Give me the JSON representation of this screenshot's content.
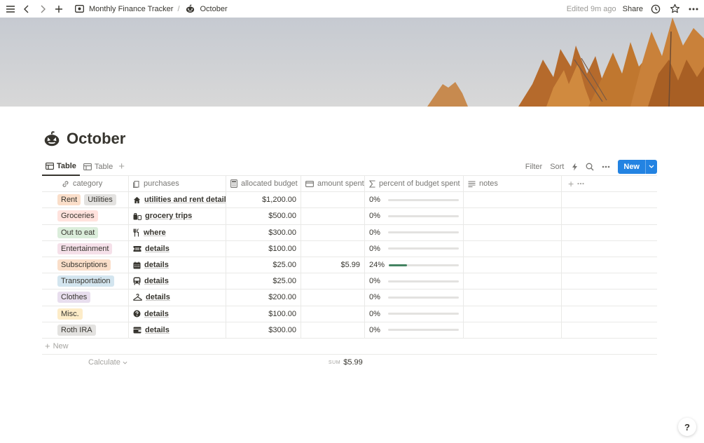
{
  "topbar": {
    "breadcrumb": [
      {
        "label": "Monthly Finance Tracker",
        "icon": "tracker-icon"
      },
      {
        "label": "October",
        "icon": "pumpkin-icon"
      }
    ],
    "separator": "/",
    "edited": "Edited 9m ago",
    "share_label": "Share"
  },
  "page": {
    "title": "October",
    "title_icon": "pumpkin-icon"
  },
  "views": {
    "tabs": [
      {
        "label": "Table",
        "active": true
      },
      {
        "label": "Table",
        "active": false
      }
    ],
    "filter_label": "Filter",
    "sort_label": "Sort",
    "new_label": "New"
  },
  "table": {
    "columns": [
      {
        "label": "category",
        "icon": "link-icon"
      },
      {
        "label": "purchases",
        "icon": "doc-icon"
      },
      {
        "label": "allocated budget",
        "icon": "calculator-icon"
      },
      {
        "label": "amount spent",
        "icon": "card-icon"
      },
      {
        "label": "percent of budget spent",
        "icon": "sigma-icon"
      },
      {
        "label": "notes",
        "icon": "lines-icon"
      }
    ],
    "rows": [
      {
        "tags": [
          {
            "label": "Rent",
            "color": "#fadec9"
          },
          {
            "label": "Utilities",
            "color": "#e3e2e0"
          }
        ],
        "purchase_icon": "house-icon",
        "purchase": "utilities and rent details",
        "budget": "$1,200.00",
        "spent": "",
        "percent": "0%",
        "fraction": 0
      },
      {
        "tags": [
          {
            "label": "Groceries",
            "color": "#ffe2dd"
          }
        ],
        "purchase_icon": "bag-icon",
        "purchase": "grocery trips",
        "budget": "$500.00",
        "spent": "",
        "percent": "0%",
        "fraction": 0
      },
      {
        "tags": [
          {
            "label": "Out to eat",
            "color": "#dbeddb"
          }
        ],
        "purchase_icon": "fork-knife-icon",
        "purchase": "where",
        "budget": "$300.00",
        "spent": "",
        "percent": "0%",
        "fraction": 0
      },
      {
        "tags": [
          {
            "label": "Entertainment",
            "color": "#f5e0e9"
          }
        ],
        "purchase_icon": "ticket-icon",
        "purchase": "details",
        "budget": "$100.00",
        "spent": "",
        "percent": "0%",
        "fraction": 0
      },
      {
        "tags": [
          {
            "label": "Subscriptions",
            "color": "#fadec9"
          }
        ],
        "purchase_icon": "calendar-icon",
        "purchase": "details",
        "budget": "$25.00",
        "spent": "$5.99",
        "percent": "24%",
        "fraction": 0.24
      },
      {
        "tags": [
          {
            "label": "Transportation",
            "color": "#d3e5ef"
          }
        ],
        "purchase_icon": "bus-icon",
        "purchase": "details",
        "budget": "$25.00",
        "spent": "",
        "percent": "0%",
        "fraction": 0
      },
      {
        "tags": [
          {
            "label": "Clothes",
            "color": "#e8deee"
          }
        ],
        "purchase_icon": "hanger-icon",
        "purchase": "details",
        "budget": "$200.00",
        "spent": "",
        "percent": "0%",
        "fraction": 0
      },
      {
        "tags": [
          {
            "label": "Misc.",
            "color": "#fdecc8"
          }
        ],
        "purchase_icon": "question-icon",
        "purchase": "details",
        "budget": "$100.00",
        "spent": "",
        "percent": "0%",
        "fraction": 0
      },
      {
        "tags": [
          {
            "label": "Roth IRA",
            "color": "#e3e2e0"
          }
        ],
        "purchase_icon": "wallet-icon",
        "purchase": "details",
        "budget": "$300.00",
        "spent": "",
        "percent": "0%",
        "fraction": 0
      }
    ],
    "new_row_label": "New",
    "calculate_label": "Calculate",
    "sum_key": "SUM",
    "sum_value": "$5.99"
  },
  "help_label": "?",
  "colors": {
    "accent": "#2383e2",
    "progress_fill": "#448361",
    "progress_track": "#e3e2e0"
  }
}
